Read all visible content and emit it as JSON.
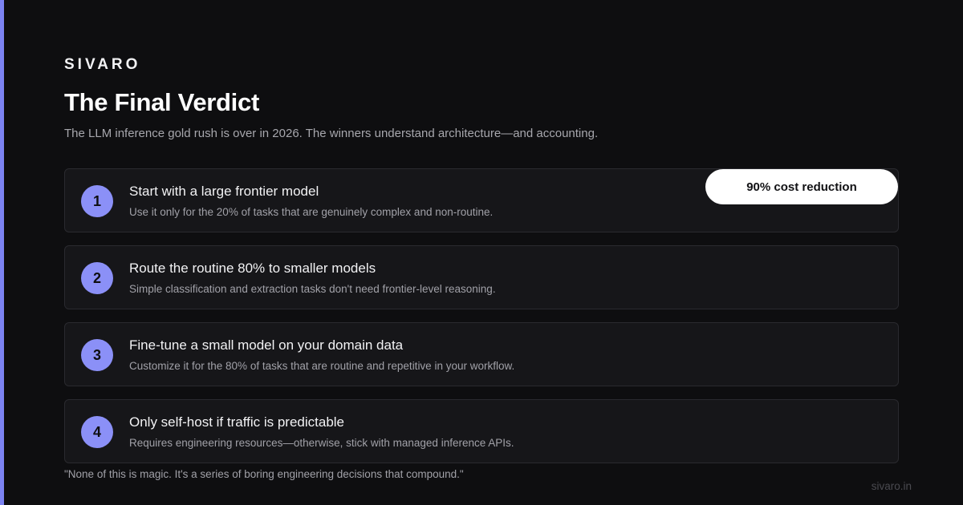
{
  "brand": "SIVARO",
  "title": "The Final Verdict",
  "subtitle": "The LLM inference gold rush is over in 2026. The winners understand architecture—and accounting.",
  "steps": [
    {
      "number": "1",
      "title": "Start with a large frontier model",
      "description": "Use it only for the 20% of tasks that are genuinely complex and non-routine."
    },
    {
      "number": "2",
      "title": "Route the routine 80% to smaller models",
      "description": "Simple classification and extraction tasks don't need frontier-level reasoning."
    },
    {
      "number": "3",
      "title": "Fine-tune a small model on your domain data",
      "description": "Customize it for the 80% of tasks that are routine and repetitive in your workflow."
    },
    {
      "number": "4",
      "title": "Only self-host if traffic is predictable",
      "description": "Requires engineering resources—otherwise, stick with managed inference APIs."
    }
  ],
  "badge": "90% cost reduction",
  "quote": "\"None of this is magic. It's a series of boring engineering decisions that compound.\"",
  "footer_domain": "sivaro.in",
  "colors": {
    "background": "#0e0e10",
    "accent": "#7c83f2",
    "step_number": "#8b90f7",
    "card": "#161619",
    "badge": "#ffffff"
  }
}
